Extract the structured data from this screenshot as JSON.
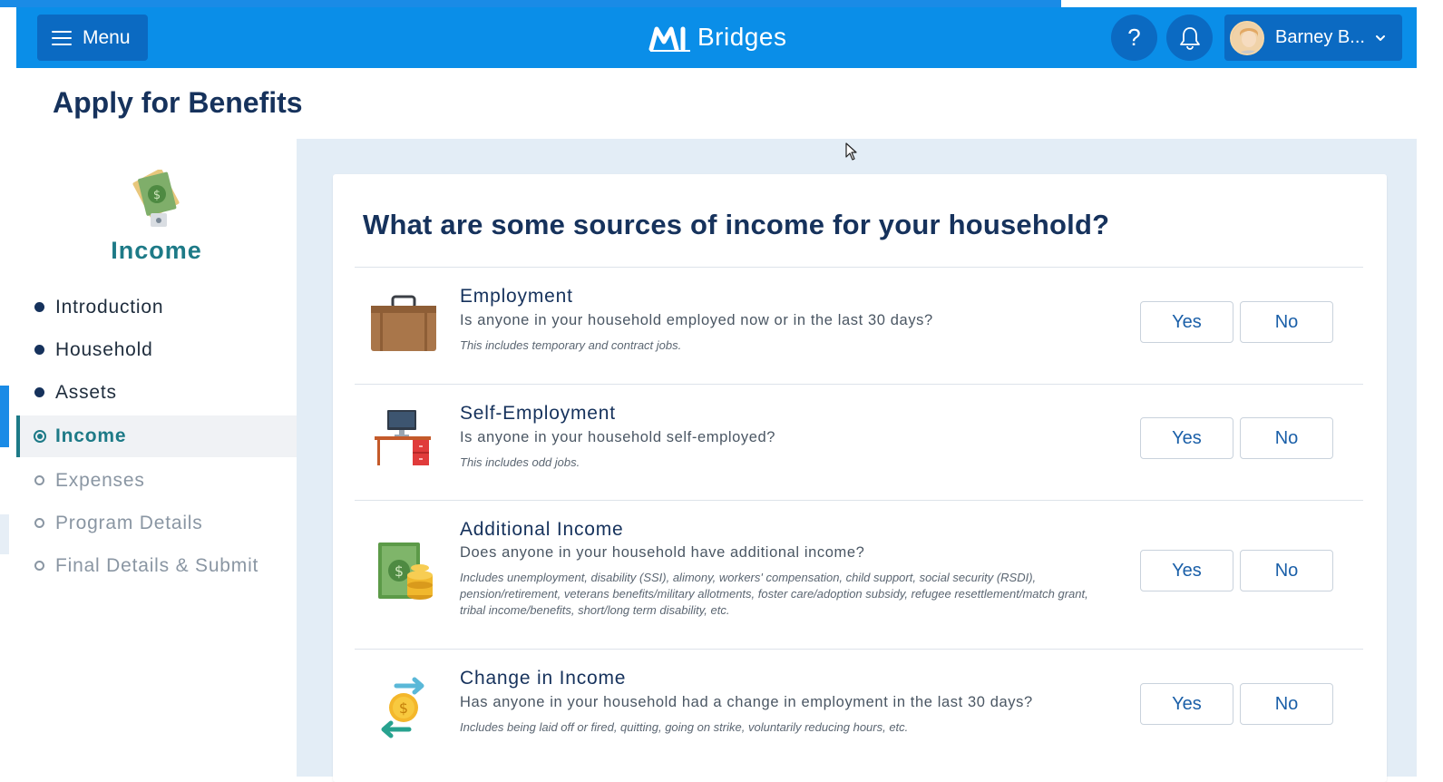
{
  "header": {
    "menu_label": "Menu",
    "brand_name": "Bridges",
    "help_label": "?",
    "user_name": "Barney B...",
    "colors": {
      "primary": "#0a8ee8",
      "button": "#0b6ac2"
    }
  },
  "page": {
    "title": "Apply for Benefits"
  },
  "sidebar": {
    "section_heading": "Income",
    "section_icon": "money-hand-icon",
    "items": [
      {
        "label": "Introduction",
        "state": "complete"
      },
      {
        "label": "Household",
        "state": "complete"
      },
      {
        "label": "Assets",
        "state": "complete"
      },
      {
        "label": "Income",
        "state": "current"
      },
      {
        "label": "Expenses",
        "state": "future"
      },
      {
        "label": "Program Details",
        "state": "future"
      },
      {
        "label": "Final Details & Submit",
        "state": "future"
      }
    ]
  },
  "main": {
    "question": "What are some sources of income for your household?",
    "yes_label": "Yes",
    "no_label": "No",
    "sources": [
      {
        "icon": "briefcase-icon",
        "title": "Employment",
        "subtitle": "Is anyone in your household employed now or in the last 30 days?",
        "note": "This includes temporary and contract jobs."
      },
      {
        "icon": "desk-computer-icon",
        "title": "Self-Employment",
        "subtitle": "Is anyone in your household self-employed?",
        "note": "This includes odd jobs."
      },
      {
        "icon": "cash-coins-icon",
        "title": "Additional Income",
        "subtitle": "Does anyone in your household have additional income?",
        "note": "Includes unemployment, disability (SSI), alimony, workers' compensation, child support, social security (RSDI), pension/retirement, veterans benefits/military allotments, foster care/adoption subsidy, refugee resettlement/match grant, tribal income/benefits, short/long term disability, etc."
      },
      {
        "icon": "coin-exchange-icon",
        "title": "Change in Income",
        "subtitle": "Has anyone in your household had a change in employment in the last 30 days?",
        "note": "Includes being laid off or fired, quitting, going on strike, voluntarily reducing hours, etc."
      }
    ]
  }
}
